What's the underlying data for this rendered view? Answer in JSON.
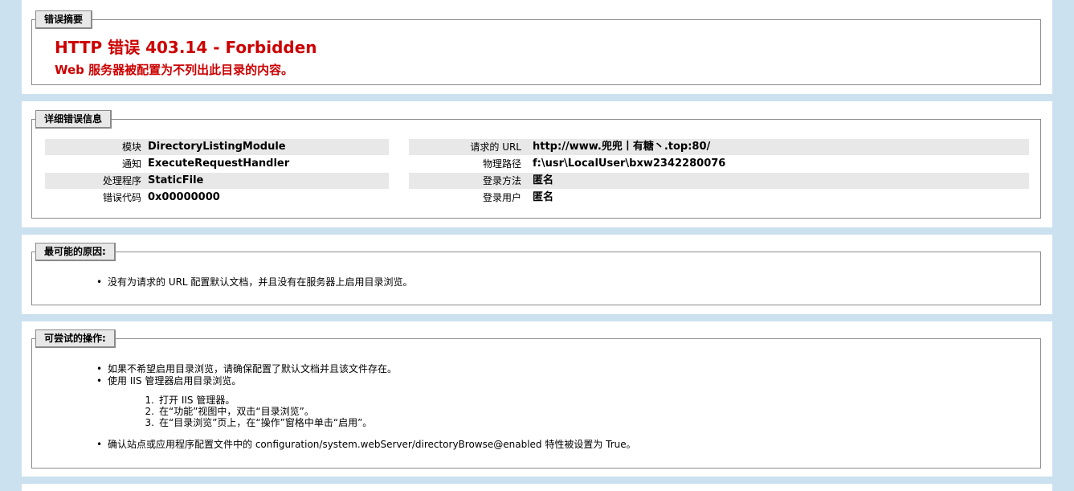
{
  "summary": {
    "legend": "错误摘要",
    "title": "HTTP 错误 403.14 - Forbidden",
    "subtitle": "Web 服务器被配置为不列出此目录的内容。"
  },
  "detail": {
    "legend": "详细错误信息",
    "left": [
      {
        "label": "模块",
        "value": "DirectoryListingModule"
      },
      {
        "label": "通知",
        "value": "ExecuteRequestHandler"
      },
      {
        "label": "处理程序",
        "value": "StaticFile"
      },
      {
        "label": "错误代码",
        "value": "0x00000000"
      }
    ],
    "right": [
      {
        "label": "请求的 URL",
        "value": "http://www.兜兜丨有糖丶.top:80/"
      },
      {
        "label": "物理路径",
        "value": "f:\\usr\\LocalUser\\bxw2342280076"
      },
      {
        "label": "登录方法",
        "value": "匿名"
      },
      {
        "label": "登录用户",
        "value": "匿名"
      }
    ]
  },
  "causes": {
    "legend": "最可能的原因:",
    "items": [
      "没有为请求的 URL 配置默认文档，并且没有在服务器上启用目录浏览。"
    ]
  },
  "actions": {
    "legend": "可尝试的操作:",
    "item1": "如果不希望启用目录浏览，请确保配置了默认文档并且该文件存在。",
    "item2": "使用 IIS 管理器启用目录浏览。",
    "steps": [
      {
        "num": "1.",
        "text": "打开 IIS 管理器。"
      },
      {
        "num": "2.",
        "text": "在“功能”视图中，双击“目录浏览”。"
      },
      {
        "num": "3.",
        "text": "在“目录浏览”页上，在“操作”窗格中单击“启用”。"
      }
    ],
    "item3": "确认站点或应用程序配置文件中的 configuration/system.webServer/directoryBrowse@enabled 特性被设置为 True。"
  }
}
